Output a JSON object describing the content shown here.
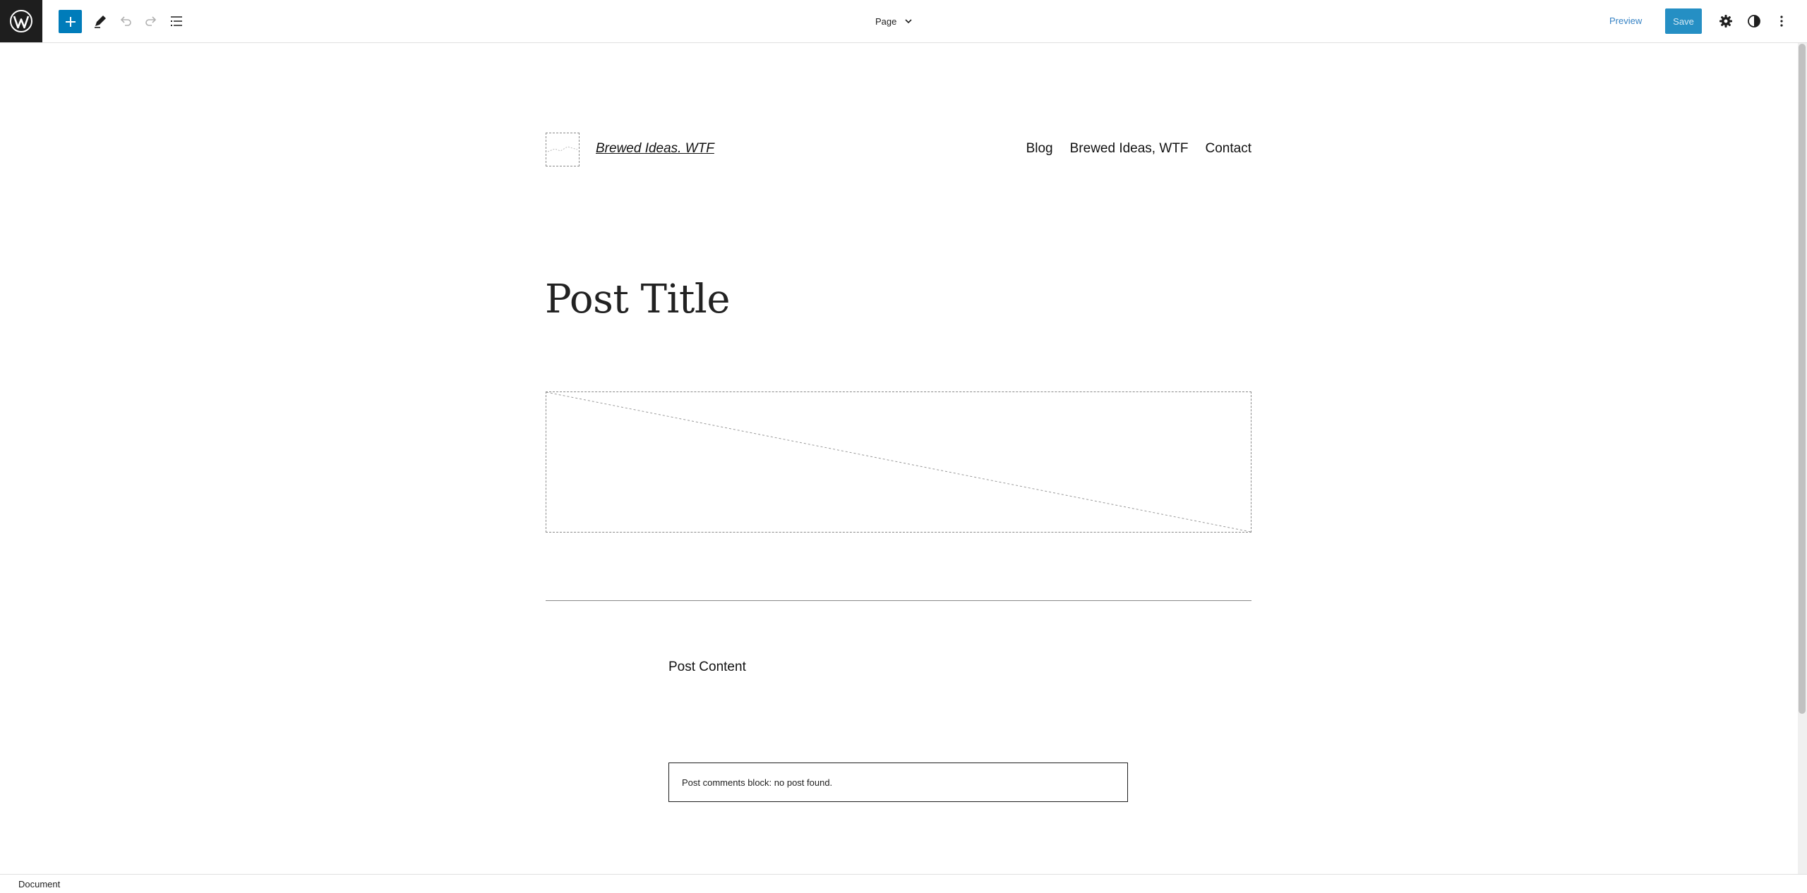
{
  "toolbar": {
    "page_selector_label": "Page",
    "preview_label": "Preview",
    "save_label": "Save",
    "colors": {
      "accent": "#007cba",
      "logo_bg": "#1e1e1e"
    },
    "icons": [
      "wordpress-icon",
      "plus-icon",
      "pencil-icon",
      "undo-icon",
      "redo-icon",
      "list-view-icon",
      "chevron-down-icon",
      "gear-icon",
      "contrast-icon",
      "kebab-menu-icon"
    ]
  },
  "header": {
    "site_title": "Brewed Ideas. WTF",
    "nav": [
      "Blog",
      "Brewed Ideas, WTF",
      "Contact"
    ]
  },
  "main": {
    "post_title": "Post Title",
    "post_content": "Post Content",
    "comments_message": "Post comments block: no post found."
  },
  "footer": {
    "breadcrumb": "Document"
  }
}
